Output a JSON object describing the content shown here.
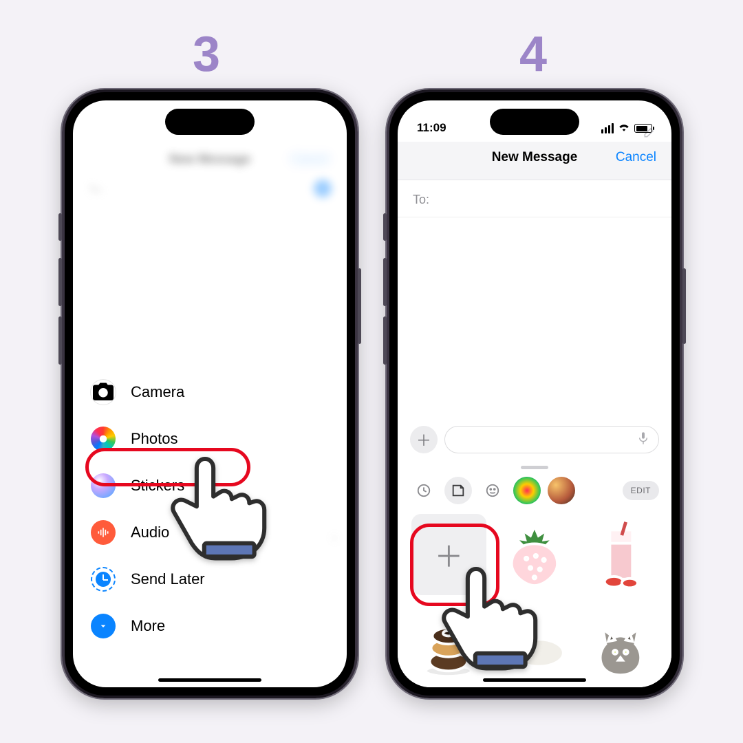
{
  "steps": {
    "left": "3",
    "right": "4"
  },
  "step3": {
    "header_title": "New Message",
    "header_cancel": "Cancel",
    "to_label": "To:",
    "menu": {
      "camera": "Camera",
      "photos": "Photos",
      "stickers": "Stickers",
      "audio": "Audio",
      "send_later": "Send Later",
      "more": "More"
    }
  },
  "step4": {
    "status_time": "11:09",
    "header_title": "New Message",
    "header_cancel": "Cancel",
    "to_label": "To:",
    "edit_label": "EDIT",
    "tabs": {
      "recent": "recent-icon",
      "stickers": "sticker-shape-icon",
      "emoji": "emoji-icon",
      "pack1": "activity-rings-icon",
      "pack2": "memoji-icon"
    },
    "stickers": [
      "add",
      "strawberry",
      "smoothie",
      "donuts",
      "white-cat",
      "gray-cat"
    ]
  },
  "colors": {
    "highlight": "#e6081f",
    "step": "#9c85c8",
    "ios_blue": "#0a84ff"
  }
}
